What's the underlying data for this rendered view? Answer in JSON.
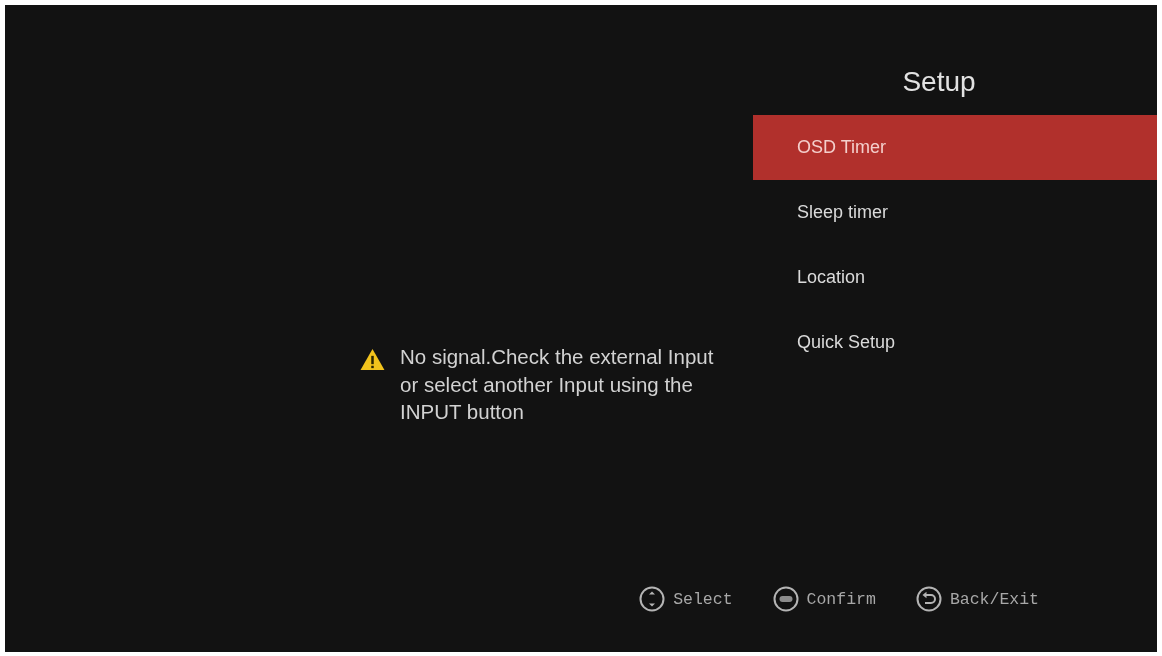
{
  "message": {
    "text": "No signal.Check the external Input or select another Input using the INPUT button"
  },
  "menu": {
    "title": "Setup",
    "items": [
      {
        "label": "OSD Timer",
        "selected": true
      },
      {
        "label": "Sleep timer",
        "selected": false
      },
      {
        "label": "Location",
        "selected": false
      },
      {
        "label": "Quick Setup",
        "selected": false
      }
    ]
  },
  "key_hints": [
    {
      "kind": "select",
      "label": "Select"
    },
    {
      "kind": "confirm",
      "label": "Confirm"
    },
    {
      "kind": "back",
      "label": "Back/Exit"
    }
  ]
}
